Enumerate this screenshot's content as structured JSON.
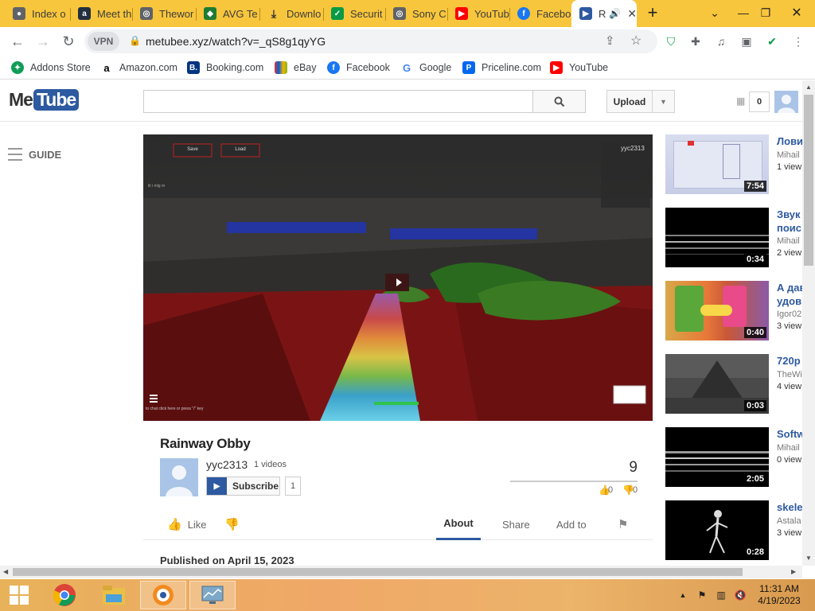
{
  "browser": {
    "tabs": [
      {
        "title": "Index o",
        "icon": "incognito-icon",
        "color": "#5f6368"
      },
      {
        "title": "Meet th",
        "icon": "amazon-icon",
        "color": "#232f3e"
      },
      {
        "title": "Thewor",
        "icon": "globe-icon",
        "color": "#5f6368"
      },
      {
        "title": "AVG Te",
        "icon": "avg-icon",
        "color": "#1e7b34"
      },
      {
        "title": "Downlo",
        "icon": "download-icon",
        "color": "#5f6368"
      },
      {
        "title": "Securit",
        "icon": "check-shield-icon",
        "color": "#0a9a46"
      },
      {
        "title": "Sony C",
        "icon": "globe-icon",
        "color": "#5f6368"
      },
      {
        "title": "YouTub",
        "icon": "youtube-icon",
        "color": "#ff0000"
      },
      {
        "title": "Facebo",
        "icon": "facebook-icon",
        "color": "#1877f2"
      },
      {
        "title": "R",
        "icon": "metube-icon",
        "color": "#2d5aa0"
      }
    ],
    "url": "metubee.xyz/watch?v=_qS8g1qyYG",
    "vpn_label": "VPN",
    "bookmarks": [
      {
        "label": "Addons Store",
        "color": "#0f9d58"
      },
      {
        "label": "Amazon.com",
        "color": "#232f3e"
      },
      {
        "label": "Booking.com",
        "color": "#003580"
      },
      {
        "label": "eBay",
        "color": "#e53238"
      },
      {
        "label": "Facebook",
        "color": "#1877f2"
      },
      {
        "label": "Google",
        "color": "#4285f4"
      },
      {
        "label": "Priceline.com",
        "color": "#0068ef"
      },
      {
        "label": "YouTube",
        "color": "#ff0000"
      }
    ]
  },
  "site": {
    "logo_me": "Me",
    "logo_tube": "Tube",
    "search_placeholder": "",
    "upload_label": "Upload",
    "notif_count": "0",
    "guide_label": "GUIDE"
  },
  "player": {
    "hud_btn_1": "Save",
    "hud_btn_2": "Load",
    "hud_user": "yyc2313",
    "hud_hint": "to chat click here or press \"/\" key",
    "hud_topleft": "lit i mlg m"
  },
  "video": {
    "title": "Rainway Obby",
    "owner": "yyc2313",
    "owner_videos": "1 videos",
    "subscribe_label": "Subscribe",
    "subscriber_count": "1",
    "views": "9",
    "likes": "0",
    "dislikes": "0",
    "like_label": "Like",
    "tabs": [
      "About",
      "Share",
      "Add to"
    ],
    "published": "Published on April 15, 2023"
  },
  "related": [
    {
      "title": "Лови",
      "channel": "Mihail",
      "views": "1 view",
      "duration": "7:54"
    },
    {
      "title": "Звук поис",
      "channel": "Mihail",
      "views": "2 view",
      "duration": "0:34"
    },
    {
      "title": "А дав удов",
      "channel": "Igor02",
      "views": "3 view",
      "duration": "0:40"
    },
    {
      "title": "720p",
      "channel": "TheWi",
      "views": "4 view",
      "duration": "0:03"
    },
    {
      "title": "Softw",
      "channel": "Mihail",
      "views": "0 view",
      "duration": "2:05"
    },
    {
      "title": "skele",
      "channel": "Astala",
      "views": "3 view",
      "duration": "0:28"
    }
  ],
  "taskbar": {
    "time": "11:31 AM",
    "date": "4/19/2023"
  }
}
